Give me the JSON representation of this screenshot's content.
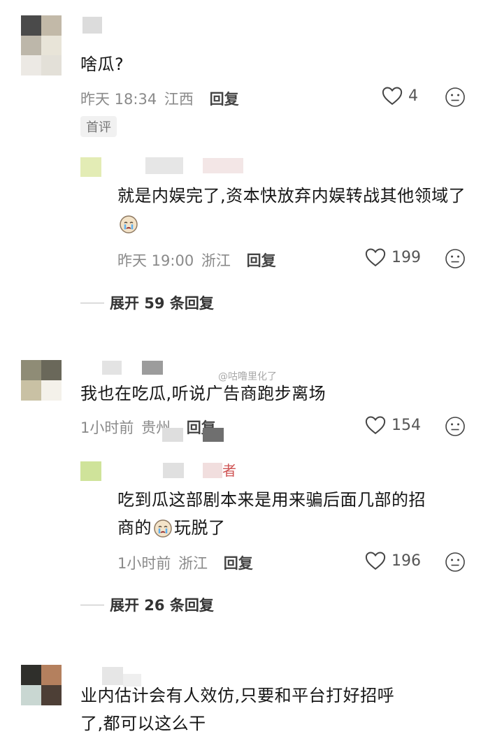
{
  "comments": [
    {
      "text": "啥瓜?",
      "time": "昨天 18:34",
      "location": "江西",
      "reply_label": "回复",
      "likes": "4",
      "badge": "首评",
      "reply": {
        "text": "就是内娱完了,资本快放弃内娱转战其他领域了",
        "time": "昨天 19:00",
        "location": "浙江",
        "reply_label": "回复",
        "likes": "199"
      },
      "expand": "展开 59 条回复"
    },
    {
      "text": "我也在吃瓜,听说广告商跑步离场",
      "time": "1小时前",
      "location": "贵州",
      "reply_label": "回复",
      "likes": "154",
      "reply": {
        "author_tag": "者",
        "text_part1": "吃到瓜这部剧本来是用来骗后面几部的招",
        "text_part2_a": "商的",
        "text_part2_b": "玩脱了",
        "time": "1小时前",
        "location": "浙江",
        "reply_label": "回复",
        "likes": "196"
      },
      "expand": "展开 26 条回复"
    },
    {
      "text_line1": "业内估计会有人效仿,只要和平台打好招呼",
      "text_line2": "了,都可以这么干"
    }
  ],
  "watermark": "@咕噜里化了",
  "icons": {
    "like": "heart-outline-icon",
    "dislike": "neutral-face-icon"
  }
}
